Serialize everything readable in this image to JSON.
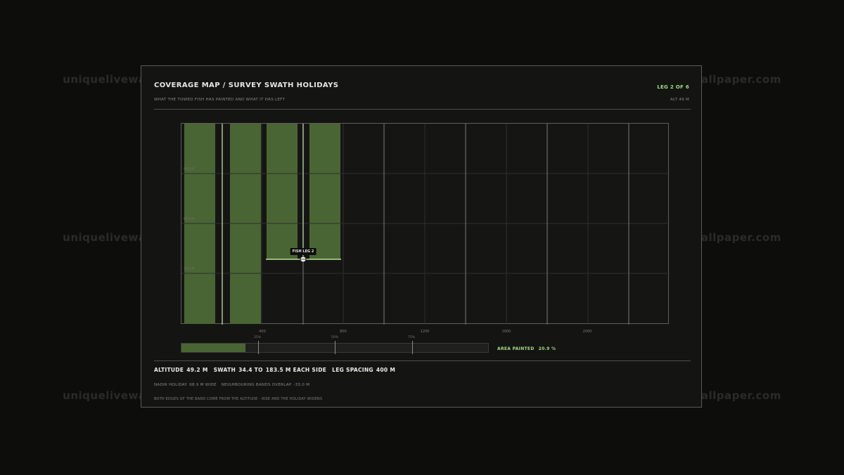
{
  "watermark": "uniquelivewallpaper.com",
  "header": {
    "title": "COVERAGE MAP / SURVEY SWATH HOLIDAYS",
    "subtitle": "WHAT THE TOWED FISH HAS PAINTED AND WHAT IT HAS LEFT",
    "leg_status": "LEG 2 OF 6",
    "altitude_readout": "ALT 49 M"
  },
  "colors": {
    "painted": "#4a6534",
    "accent": "#a6dc86",
    "grid": "#2e2e2b"
  },
  "coverage_map": {
    "y_ticks": [
      "900 M",
      "600 M",
      "300 M"
    ],
    "x_ticks": [
      "400",
      "800",
      "1200",
      "1600",
      "2000"
    ],
    "fish_label": "FISH LEG 2"
  },
  "progress": {
    "tick_labels": [
      "25%",
      "50%",
      "75%"
    ],
    "fill_fraction": 0.209,
    "label": "AREA PAINTED",
    "value": "20.9 %"
  },
  "stats": {
    "altitude_label": "ALTITUDE",
    "altitude_value": "49.2 M",
    "swath_label": "SWATH",
    "swath_value": "34.4 TO",
    "swath_max": "183.5 M EACH SIDE",
    "spacing_label": "LEG SPACING",
    "spacing_value": "400 M"
  },
  "nadir": {
    "label": "NADIR HOLIDAY",
    "width": "68.9 M WIDE",
    "overlap_label": "NEIGHBOURING BANDS OVERLAP",
    "overlap_value": "-33.0 M"
  },
  "note": "BOTH EDGES OF THE BAND COME FROM THE ALTITUDE - RISE AND THE HOLIDAY WIDENS"
}
